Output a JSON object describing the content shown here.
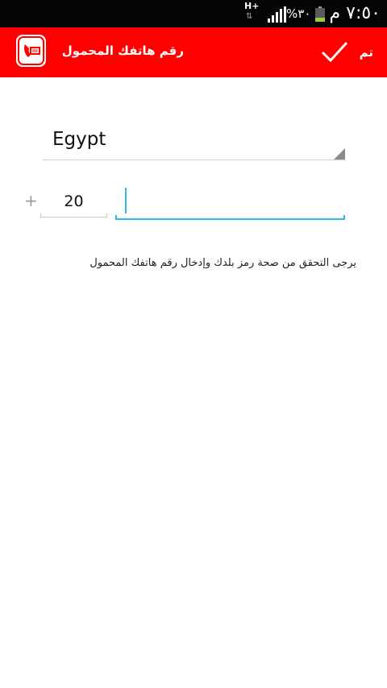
{
  "status_bar": {
    "time": "٧:٥٠ م",
    "battery_percent": "٣٠%",
    "network_type": "H+",
    "network_arrows": "⇅",
    "battery_level": 0.3,
    "icons": [
      "network-type-icon",
      "signal-icon",
      "battery-icon"
    ]
  },
  "action_bar": {
    "title": "رقم هاتفك المحمول",
    "done_label": "تم",
    "background_color": "#ff0000",
    "icons": [
      "phone-app-icon",
      "check-icon"
    ]
  },
  "form": {
    "country": "Egypt",
    "plus_sign": "+",
    "country_code": "20",
    "phone_number": "",
    "phone_field_accent_color": "#33b5e5"
  },
  "hint": "يرجى التحقق من صحة رمز بلدك وإدخال رقم هاتفك المحمول"
}
